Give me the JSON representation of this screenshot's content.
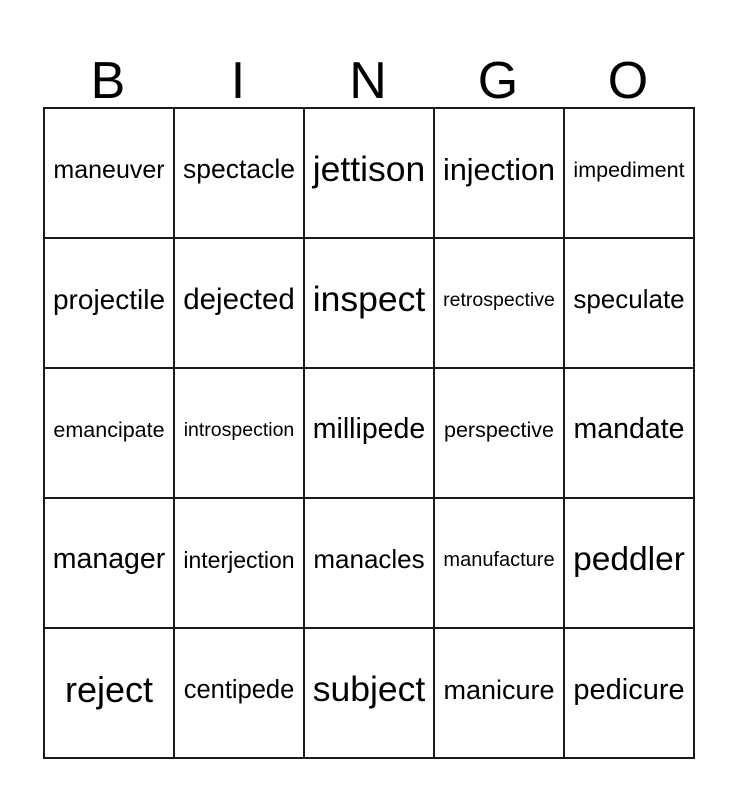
{
  "card": {
    "title": "BINGO",
    "header_letters": [
      "B",
      "I",
      "N",
      "G",
      "O"
    ],
    "columns": 5,
    "rows": 5,
    "border_color": "#1a1a1a",
    "background_color": "#ffffff",
    "text_color": "#000000",
    "free_space": false,
    "grid": [
      [
        "maneuver",
        "spectacle",
        "jettison",
        "injection",
        "impediment"
      ],
      [
        "projectile",
        "dejected",
        "inspect",
        "retrospective",
        "speculate"
      ],
      [
        "emancipate",
        "introspection",
        "millipede",
        "perspective",
        "mandate"
      ],
      [
        "manager",
        "interjection",
        "manacles",
        "manufacture",
        "peddler"
      ],
      [
        "reject",
        "centipede",
        "subject",
        "manicure",
        "pedicure"
      ]
    ]
  }
}
